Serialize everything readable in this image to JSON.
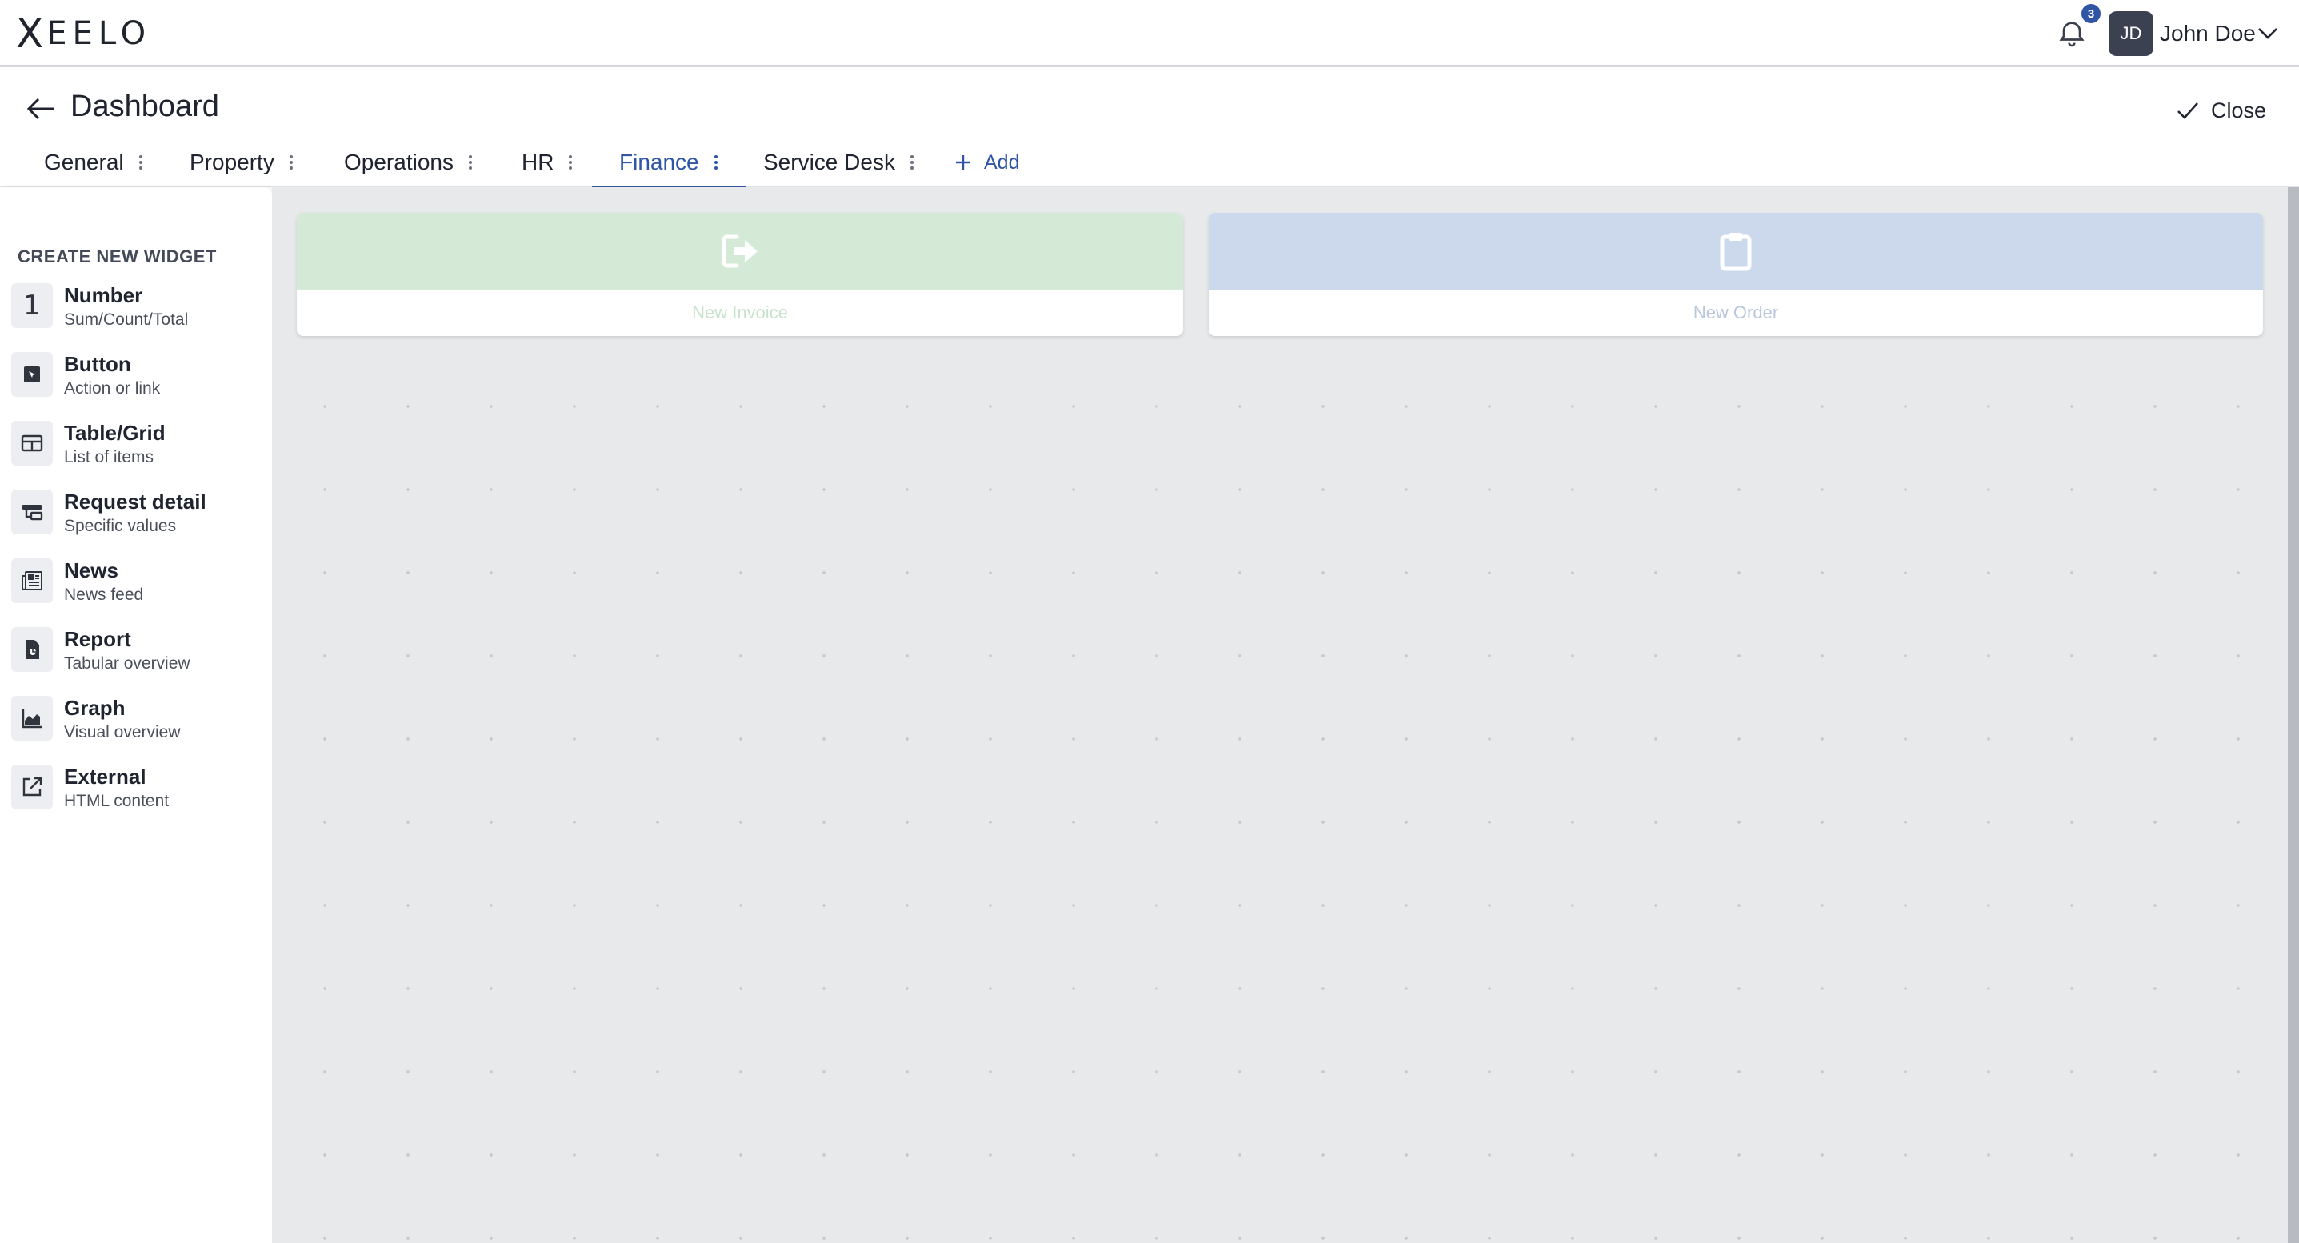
{
  "app": {
    "logo": "XEELO"
  },
  "topbar": {
    "notification_count": "3",
    "avatar_initials": "JD",
    "user_name": "John Doe"
  },
  "header": {
    "title": "Dashboard",
    "close_label": "Close"
  },
  "tabs": [
    {
      "label": "General"
    },
    {
      "label": "Property"
    },
    {
      "label": "Operations"
    },
    {
      "label": "HR"
    },
    {
      "label": "Finance",
      "active": true
    },
    {
      "label": "Service Desk"
    }
  ],
  "add_tab_label": "Add",
  "sidebar": {
    "title": "CREATE NEW WIDGET",
    "items": [
      {
        "name": "Number",
        "desc": "Sum/Count/Total",
        "icon": "number-one-icon",
        "glyph": "1"
      },
      {
        "name": "Button",
        "desc": "Action or link",
        "icon": "button-icon"
      },
      {
        "name": "Table/Grid",
        "desc": "List of items",
        "icon": "table-icon"
      },
      {
        "name": "Request detail",
        "desc": "Specific values",
        "icon": "request-detail-icon"
      },
      {
        "name": "News",
        "desc": "News feed",
        "icon": "news-icon"
      },
      {
        "name": "Report",
        "desc": "Tabular overview",
        "icon": "report-icon"
      },
      {
        "name": "Graph",
        "desc": "Visual overview",
        "icon": "graph-icon"
      },
      {
        "name": "External",
        "desc": "HTML content",
        "icon": "external-link-icon"
      }
    ]
  },
  "widgets": [
    {
      "label": "New Invoice",
      "icon": "sign-out-icon",
      "color": "#d4ead6",
      "label_color": "#c8e3cb"
    },
    {
      "label": "New Order",
      "icon": "clipboard-icon",
      "color": "#ccd8eb",
      "label_color": "#b9c8de"
    }
  ],
  "colors": {
    "accent": "#2f55a4",
    "canvas": "#e8e9eb"
  }
}
